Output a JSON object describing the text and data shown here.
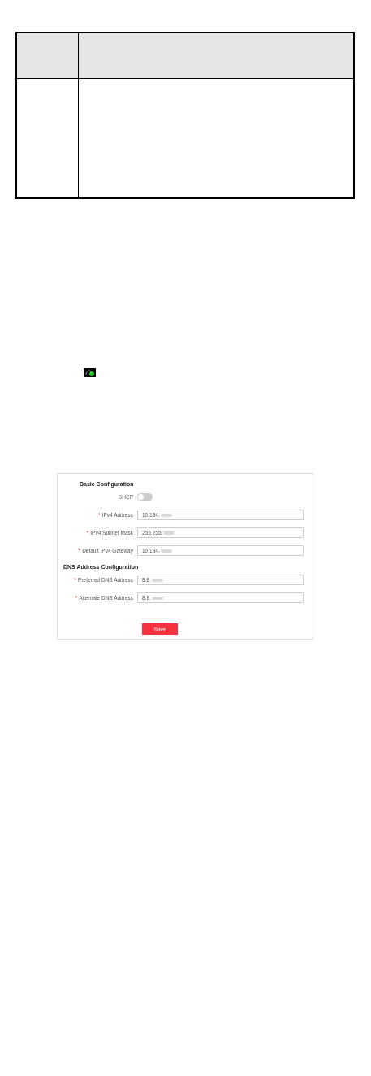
{
  "form": {
    "sections": [
      {
        "title": "Basic Configuration",
        "fields": [
          {
            "kind": "toggle",
            "label": "DHCP",
            "required": false,
            "on": false
          },
          {
            "kind": "text",
            "label": "IPv4 Address",
            "required": true,
            "value": "10.184.",
            "redacted": true
          },
          {
            "kind": "text",
            "label": "IPv4 Subnet Mask",
            "required": true,
            "value": "255.255.",
            "redacted": true
          },
          {
            "kind": "text",
            "label": "Default IPv4 Gateway",
            "required": true,
            "value": "10.184.",
            "redacted": true
          }
        ]
      },
      {
        "title": "DNS Address Configuration",
        "fields": [
          {
            "kind": "text",
            "label": "Preferred DNS Address",
            "required": true,
            "value": "8.8.",
            "redacted": true
          },
          {
            "kind": "text",
            "label": "Alternate DNS Address",
            "required": true,
            "value": "8.8.",
            "redacted": true
          }
        ]
      }
    ],
    "required_mark": "*",
    "save_button": "Save"
  }
}
